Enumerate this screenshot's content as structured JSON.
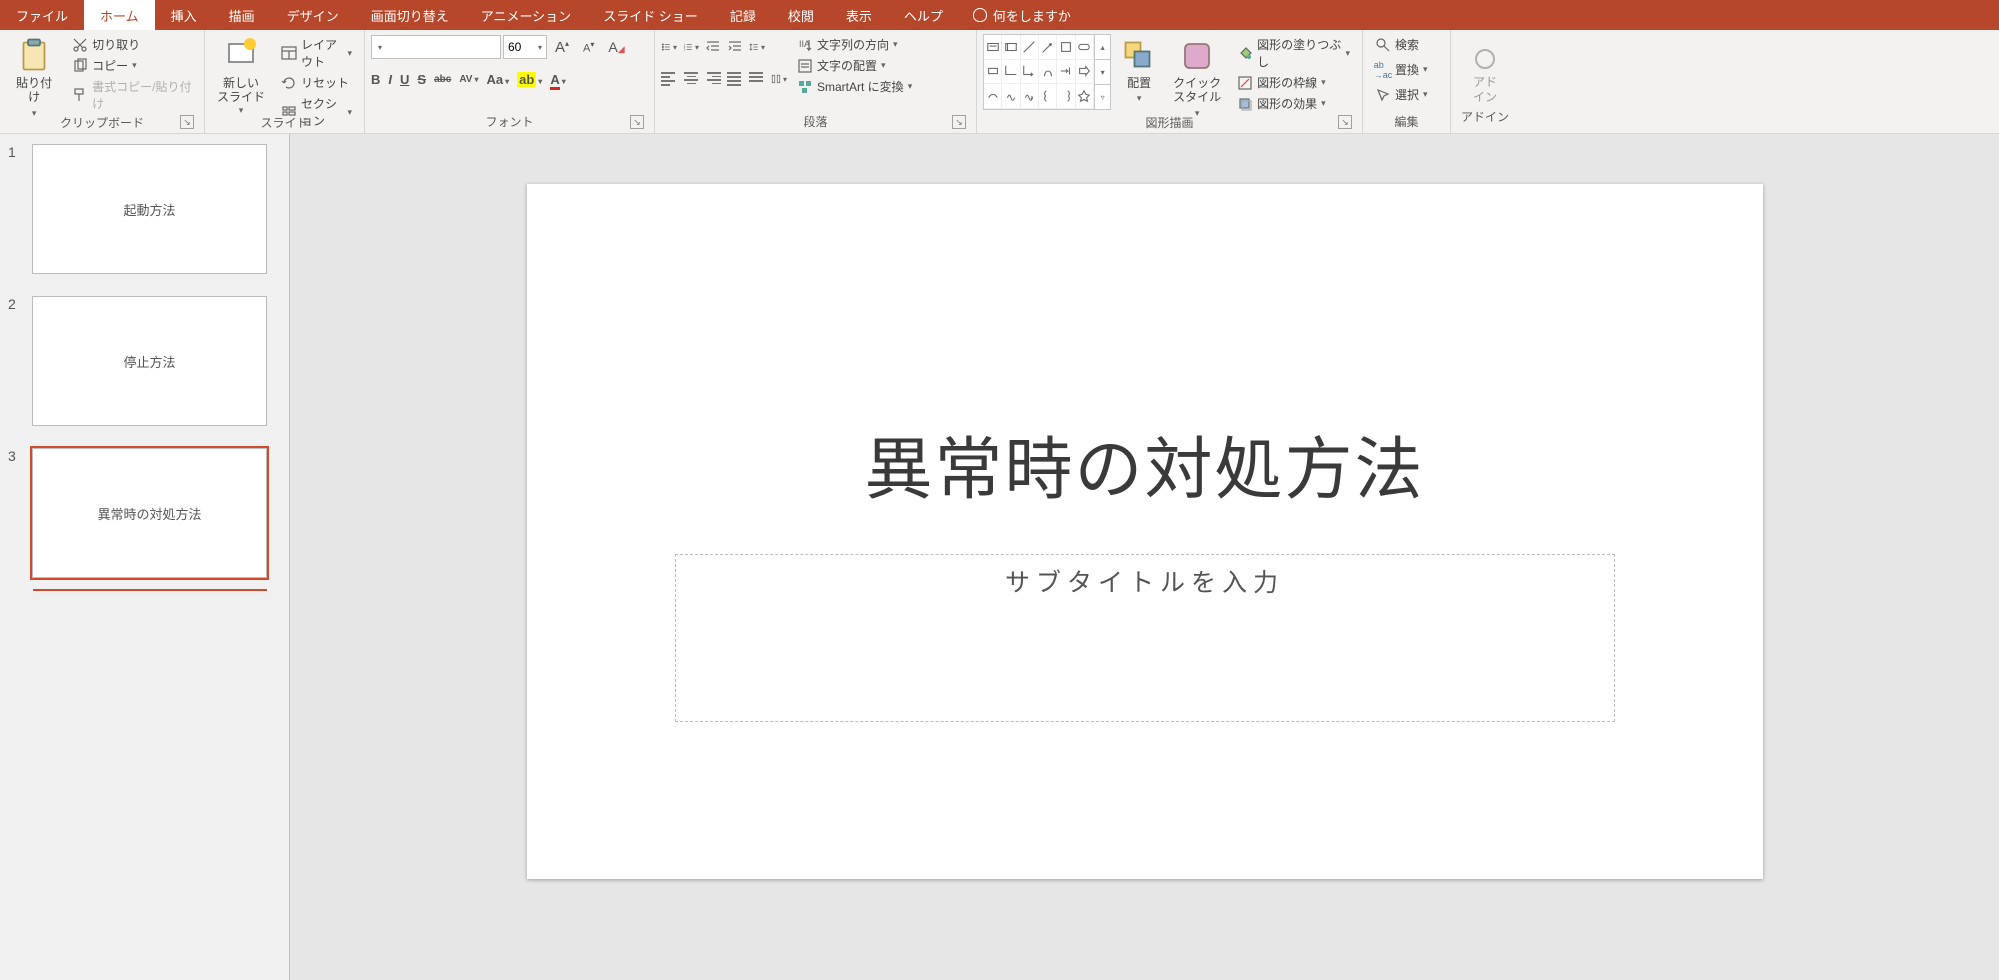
{
  "tabs": {
    "file": "ファイル",
    "home": "ホーム",
    "insert": "挿入",
    "draw": "描画",
    "design": "デザイン",
    "transitions": "画面切り替え",
    "animations": "アニメーション",
    "slideshow": "スライド ショー",
    "record": "記録",
    "review": "校閲",
    "view": "表示",
    "help": "ヘルプ",
    "tellme": "何をしますか"
  },
  "ribbon": {
    "clipboard": {
      "label": "クリップボード",
      "paste": "貼り付け",
      "cut": "切り取り",
      "copy": "コピー",
      "format_painter": "書式コピー/貼り付け"
    },
    "slides": {
      "label": "スライド",
      "new_slide": "新しい\nスライド",
      "layout": "レイアウト",
      "reset": "リセット",
      "section": "セクション"
    },
    "font": {
      "label": "フォント",
      "size": "60",
      "bold": "B",
      "italic": "I",
      "underline": "U",
      "strike": "S",
      "shadow": "abc",
      "spacing": "AV",
      "case": "Aa",
      "resetfont": "A",
      "color": "A"
    },
    "paragraph": {
      "label": "段落",
      "text_direction": "文字列の方向",
      "align_text": "文字の配置",
      "smartart": "SmartArt に変換"
    },
    "drawing": {
      "label": "図形描画",
      "arrange": "配置",
      "quick_styles": "クイック\nスタイル",
      "shape_fill": "図形の塗りつぶし",
      "shape_outline": "図形の枠線",
      "shape_effects": "図形の効果"
    },
    "editing": {
      "label": "編集",
      "find": "検索",
      "replace": "置換",
      "select": "選択"
    },
    "addins": {
      "label": "アドイン",
      "btn": "アド\nイン"
    }
  },
  "thumbnails": [
    {
      "num": "1",
      "title": "起動方法"
    },
    {
      "num": "2",
      "title": "停止方法"
    },
    {
      "num": "3",
      "title": "異常時の対処方法"
    }
  ],
  "slide": {
    "title": "異常時の対処方法",
    "subtitle_placeholder": "サブタイトルを入力"
  }
}
